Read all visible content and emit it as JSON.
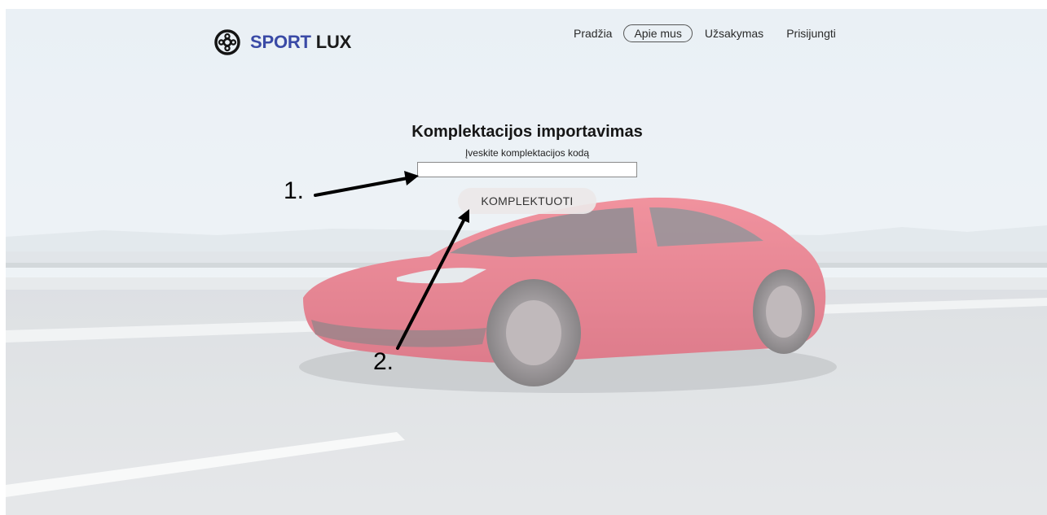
{
  "brand": {
    "name_part1": "SPORT",
    "name_part2": "LUX",
    "icon": "steering-wheel-icon",
    "color_primary": "#3a4aa6"
  },
  "nav": {
    "home": "Pradžia",
    "about": "Apie mus",
    "order": "Užsakymas",
    "login": "Prisijungti"
  },
  "form": {
    "title": "Komplektacijos importavimas",
    "subtitle": "Įveskite komplektacijos kodą",
    "code_value": "",
    "submit_label": "KOMPLEKTUOTI"
  },
  "annotations": {
    "step1": "1.",
    "step2": "2."
  }
}
